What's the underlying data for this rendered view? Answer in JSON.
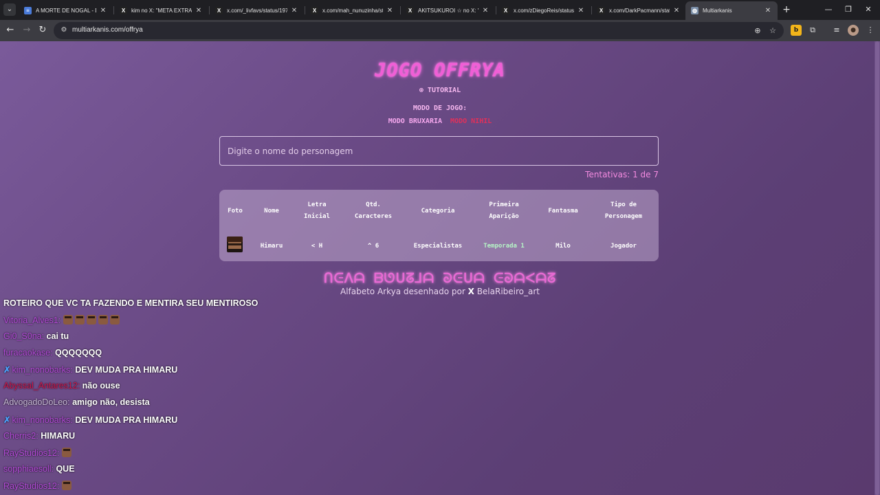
{
  "browser": {
    "tabs": [
      {
        "title": "A MORTE DE NOGAL - Do",
        "favicon": "docs-icon",
        "color": "#4a7bd9",
        "glyph": "≡"
      },
      {
        "title": "kim no X: \"META EXTRA 🤘",
        "favicon": "x-icon",
        "color": "#222222",
        "glyph": "X"
      },
      {
        "title": "x.com/_livfavs/status/197",
        "favicon": "x-icon",
        "color": "#222222",
        "glyph": "X"
      },
      {
        "title": "x.com/mah_nunuzinha/sta",
        "favicon": "x-icon",
        "color": "#222222",
        "glyph": "X"
      },
      {
        "title": "AKITSUKUROI ☆ no X: \"Ex",
        "favicon": "x-icon",
        "color": "#222222",
        "glyph": "X"
      },
      {
        "title": "x.com/zDiegoReis/status/",
        "favicon": "x-icon",
        "color": "#222222",
        "glyph": "X"
      },
      {
        "title": "x.com/DarkPacmann/stat",
        "favicon": "x-icon",
        "color": "#222222",
        "glyph": "X"
      },
      {
        "title": "Multiarkanis",
        "favicon": "globe-icon",
        "color": "#7a8ea8",
        "glyph": "◍"
      }
    ],
    "active_tab": 7,
    "url": "multiarkanis.com/offrya"
  },
  "page": {
    "title": "JOGO OFFRYA",
    "tutorial": "⊗ TUTORIAL",
    "mode_label": "MODO DE JOGO:",
    "mode_current": "MODO BRUXARIA",
    "mode_other": "MODO NIHIL",
    "input_placeholder": "Digite o nome do personagem",
    "tries": "Tentativas: 1 de 7",
    "table_headers": [
      "Foto",
      "Nome",
      "Letra Inicial",
      "Qtd. Caracteres",
      "Categoria",
      "Primeira Aparição",
      "Fantasma",
      "Tipo de Personagem"
    ],
    "row": {
      "nome": "Himaru",
      "letra": "< H",
      "qtd": "^ 6",
      "categoria": "Especialistas",
      "aparicao": "Temporada 1",
      "fantasma": "Milo",
      "tipo": "Jogador"
    },
    "arkya_text": "ᑎᕮᐱᗩ ᗷᘎᑌᘔ⅃ᗩ ᘐᕮᑌᗩ ᕮᘐᗩᐸᗩᘔ",
    "credit_prefix": "Alfabeto Arkya desenhado por",
    "credit_glyph": "X",
    "credit_handle": "BelaRibeiro_art"
  },
  "chat": [
    {
      "user": "",
      "color": "#ffffff",
      "message": "ROTEIRO QUE VC TA FAZENDO E MENTIRA SEU MENTIROSO",
      "emotes": 0,
      "badge": false
    },
    {
      "user": "Vitoria_Alves1:",
      "color": "#b44ad8",
      "message": "",
      "emotes": 5,
      "badge": false
    },
    {
      "user": "Gi0_S0na:",
      "color": "#b44ad8",
      "message": "cai tu",
      "emotes": 0,
      "badge": false
    },
    {
      "user": "furacaokase:",
      "color": "#b44ad8",
      "message": "QQQQQQQ",
      "emotes": 0,
      "badge": false
    },
    {
      "user": "kim_nonobarks:",
      "color": "#b44ad8",
      "message": "DEV MUDA PRA HIMARU",
      "emotes": 0,
      "badge": true
    },
    {
      "user": "Abyssal_Antares12:",
      "color": "#d0154b",
      "message": "não ouse",
      "emotes": 0,
      "badge": false
    },
    {
      "user": "AdvogadoDoLeo:",
      "color": "#c6b8d4",
      "message": "amigo não, desista",
      "emotes": 0,
      "badge": false
    },
    {
      "user": "kim_nonobarks:",
      "color": "#b44ad8",
      "message": "DEV MUDA PRA HIMARU",
      "emotes": 0,
      "badge": true
    },
    {
      "user": "Cherris2:",
      "color": "#b44ad8",
      "message": "HIMARU",
      "emotes": 0,
      "badge": false
    },
    {
      "user": "RayStudios12:",
      "color": "#b44ad8",
      "message": "",
      "emotes": 1,
      "badge": false
    },
    {
      "user": "sopphiaesoll:",
      "color": "#b44ad8",
      "message": "QUE",
      "emotes": 0,
      "badge": false
    },
    {
      "user": "RayStudios12:",
      "color": "#b44ad8",
      "message": "",
      "emotes": 1,
      "badge": false
    }
  ]
}
